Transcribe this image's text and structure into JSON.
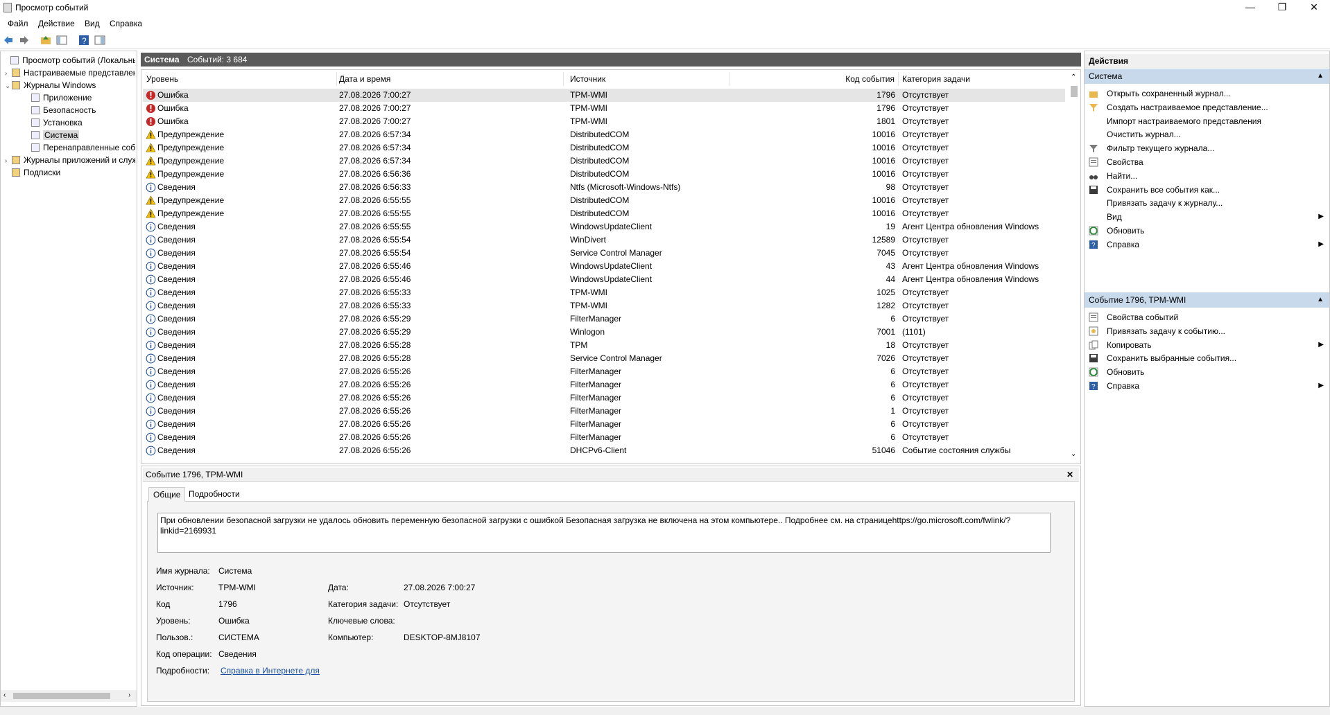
{
  "window": {
    "title": "Просмотр событий",
    "minimize": "—",
    "restore": "❐",
    "close": "✕"
  },
  "menu": [
    "Файл",
    "Действие",
    "Вид",
    "Справка"
  ],
  "tree": {
    "items": [
      {
        "label": "Просмотр событий (Локальный)",
        "arrow": ""
      },
      {
        "label": "Настраиваемые представления",
        "arrow": "›"
      },
      {
        "label": "Журналы Windows",
        "arrow": "⌄"
      },
      {
        "label": "Приложение",
        "arrow": ""
      },
      {
        "label": "Безопасность",
        "arrow": ""
      },
      {
        "label": "Установка",
        "arrow": ""
      },
      {
        "label": "Система",
        "arrow": ""
      },
      {
        "label": "Перенаправленные события",
        "arrow": ""
      },
      {
        "label": "Журналы приложений и служб",
        "arrow": "›"
      },
      {
        "label": "Подписки",
        "arrow": ""
      }
    ]
  },
  "grid": {
    "header_title": "Система",
    "header_count": "Событий: 3 684",
    "columns": [
      "Уровень",
      "Дата и время",
      "Источник",
      "Код события",
      "Категория задачи"
    ],
    "rows": [
      {
        "level": "Ошибка",
        "type": "error",
        "date": "27.08.2026 7:00:27",
        "source": "TPM-WMI",
        "code": "1796",
        "category": "Отсутствует"
      },
      {
        "level": "Ошибка",
        "type": "error",
        "date": "27.08.2026 7:00:27",
        "source": "TPM-WMI",
        "code": "1796",
        "category": "Отсутствует"
      },
      {
        "level": "Ошибка",
        "type": "error",
        "date": "27.08.2026 7:00:27",
        "source": "TPM-WMI",
        "code": "1801",
        "category": "Отсутствует"
      },
      {
        "level": "Предупреждение",
        "type": "warn",
        "date": "27.08.2026 6:57:34",
        "source": "DistributedCOM",
        "code": "10016",
        "category": "Отсутствует"
      },
      {
        "level": "Предупреждение",
        "type": "warn",
        "date": "27.08.2026 6:57:34",
        "source": "DistributedCOM",
        "code": "10016",
        "category": "Отсутствует"
      },
      {
        "level": "Предупреждение",
        "type": "warn",
        "date": "27.08.2026 6:57:34",
        "source": "DistributedCOM",
        "code": "10016",
        "category": "Отсутствует"
      },
      {
        "level": "Предупреждение",
        "type": "warn",
        "date": "27.08.2026 6:56:36",
        "source": "DistributedCOM",
        "code": "10016",
        "category": "Отсутствует"
      },
      {
        "level": "Сведения",
        "type": "info",
        "date": "27.08.2026 6:56:33",
        "source": "Ntfs (Microsoft-Windows-Ntfs)",
        "code": "98",
        "category": "Отсутствует"
      },
      {
        "level": "Предупреждение",
        "type": "warn",
        "date": "27.08.2026 6:55:55",
        "source": "DistributedCOM",
        "code": "10016",
        "category": "Отсутствует"
      },
      {
        "level": "Предупреждение",
        "type": "warn",
        "date": "27.08.2026 6:55:55",
        "source": "DistributedCOM",
        "code": "10016",
        "category": "Отсутствует"
      },
      {
        "level": "Сведения",
        "type": "info",
        "date": "27.08.2026 6:55:55",
        "source": "WindowsUpdateClient",
        "code": "19",
        "category": "Агент Центра обновления Windows"
      },
      {
        "level": "Сведения",
        "type": "info",
        "date": "27.08.2026 6:55:54",
        "source": "WinDivert",
        "code": "12589",
        "category": "Отсутствует"
      },
      {
        "level": "Сведения",
        "type": "info",
        "date": "27.08.2026 6:55:54",
        "source": "Service Control Manager",
        "code": "7045",
        "category": "Отсутствует"
      },
      {
        "level": "Сведения",
        "type": "info",
        "date": "27.08.2026 6:55:46",
        "source": "WindowsUpdateClient",
        "code": "43",
        "category": "Агент Центра обновления Windows"
      },
      {
        "level": "Сведения",
        "type": "info",
        "date": "27.08.2026 6:55:46",
        "source": "WindowsUpdateClient",
        "code": "44",
        "category": "Агент Центра обновления Windows"
      },
      {
        "level": "Сведения",
        "type": "info",
        "date": "27.08.2026 6:55:33",
        "source": "TPM-WMI",
        "code": "1025",
        "category": "Отсутствует"
      },
      {
        "level": "Сведения",
        "type": "info",
        "date": "27.08.2026 6:55:33",
        "source": "TPM-WMI",
        "code": "1282",
        "category": "Отсутствует"
      },
      {
        "level": "Сведения",
        "type": "info",
        "date": "27.08.2026 6:55:29",
        "source": "FilterManager",
        "code": "6",
        "category": "Отсутствует"
      },
      {
        "level": "Сведения",
        "type": "info",
        "date": "27.08.2026 6:55:29",
        "source": "Winlogon",
        "code": "7001",
        "category": "(1101)"
      },
      {
        "level": "Сведения",
        "type": "info",
        "date": "27.08.2026 6:55:28",
        "source": "TPM",
        "code": "18",
        "category": "Отсутствует"
      },
      {
        "level": "Сведения",
        "type": "info",
        "date": "27.08.2026 6:55:28",
        "source": "Service Control Manager",
        "code": "7026",
        "category": "Отсутствует"
      },
      {
        "level": "Сведения",
        "type": "info",
        "date": "27.08.2026 6:55:26",
        "source": "FilterManager",
        "code": "6",
        "category": "Отсутствует"
      },
      {
        "level": "Сведения",
        "type": "info",
        "date": "27.08.2026 6:55:26",
        "source": "FilterManager",
        "code": "6",
        "category": "Отсутствует"
      },
      {
        "level": "Сведения",
        "type": "info",
        "date": "27.08.2026 6:55:26",
        "source": "FilterManager",
        "code": "6",
        "category": "Отсутствует"
      },
      {
        "level": "Сведения",
        "type": "info",
        "date": "27.08.2026 6:55:26",
        "source": "FilterManager",
        "code": "1",
        "category": "Отсутствует"
      },
      {
        "level": "Сведения",
        "type": "info",
        "date": "27.08.2026 6:55:26",
        "source": "FilterManager",
        "code": "6",
        "category": "Отсутствует"
      },
      {
        "level": "Сведения",
        "type": "info",
        "date": "27.08.2026 6:55:26",
        "source": "FilterManager",
        "code": "6",
        "category": "Отсутствует"
      },
      {
        "level": "Сведения",
        "type": "info",
        "date": "27.08.2026 6:55:26",
        "source": "DHCPv6-Client",
        "code": "51046",
        "category": "Событие состояния службы"
      }
    ]
  },
  "detail": {
    "title": "Событие 1796, TPM-WMI",
    "tabs": [
      "Общие",
      "Подробности"
    ],
    "message": "При обновлении безопасной загрузки не удалось обновить переменную безопасной загрузки с ошибкой Безопасная загрузка не включена на этом компьютере.. Подробнее см. на страницеhttps://go.microsoft.com/fwlink/?linkid=2169931",
    "fields": {
      "log_name_label": "Имя журнала:",
      "log_name": "Система",
      "source_label": "Источник:",
      "source": "TPM-WMI",
      "date_label": "Дата:",
      "date": "27.08.2026 7:00:27",
      "code_label": "Код",
      "code": "1796",
      "category_label": "Категория задачи:",
      "category": "Отсутствует",
      "level_label": "Уровень:",
      "level": "Ошибка",
      "keywords_label": "Ключевые слова:",
      "keywords": "",
      "user_label": "Пользов.:",
      "user": "СИСТЕМА",
      "computer_label": "Компьютер:",
      "computer": "DESKTOP-8MJ8107",
      "opcode_label": "Код операции:",
      "opcode": "Сведения",
      "more_label": "Подробности:",
      "more_link": "Справка в Интернете для"
    }
  },
  "actions": {
    "title": "Действия",
    "section1": "Система",
    "items1": [
      {
        "label": "Открыть сохраненный журнал...",
        "icon": "folder-open-icon",
        "sub": false
      },
      {
        "label": "Создать настраиваемое представление...",
        "icon": "filter-add-icon",
        "sub": false
      },
      {
        "label": "Импорт настраиваемого представления",
        "icon": "",
        "sub": false
      },
      {
        "label": "Очистить журнал...",
        "icon": "",
        "sub": false
      },
      {
        "label": "Фильтр текущего журнала...",
        "icon": "filter-icon",
        "sub": false
      },
      {
        "label": "Свойства",
        "icon": "properties-icon",
        "sub": false
      },
      {
        "label": "Найти...",
        "icon": "binoculars-icon",
        "sub": false
      },
      {
        "label": "Сохранить все события как...",
        "icon": "save-icon",
        "sub": false
      },
      {
        "label": "Привязать задачу к журналу...",
        "icon": "",
        "sub": false
      },
      {
        "label": "Вид",
        "icon": "",
        "sub": true
      },
      {
        "label": "Обновить",
        "icon": "refresh-icon",
        "sub": false
      },
      {
        "label": "Справка",
        "icon": "help-icon",
        "sub": true
      }
    ],
    "section2": "Событие 1796, TPM-WMI",
    "items2": [
      {
        "label": "Свойства событий",
        "icon": "properties-icon",
        "sub": false
      },
      {
        "label": "Привязать задачу к событию...",
        "icon": "task-icon",
        "sub": false
      },
      {
        "label": "Копировать",
        "icon": "copy-icon",
        "sub": true
      },
      {
        "label": "Сохранить выбранные события...",
        "icon": "save-icon",
        "sub": false
      },
      {
        "label": "Обновить",
        "icon": "refresh-icon",
        "sub": false
      },
      {
        "label": "Справка",
        "icon": "help-icon",
        "sub": true
      }
    ]
  },
  "colors": {
    "error": "#c62828",
    "warn": "#f2c200",
    "info": "#2b5797",
    "section": "#c9d9ec"
  }
}
